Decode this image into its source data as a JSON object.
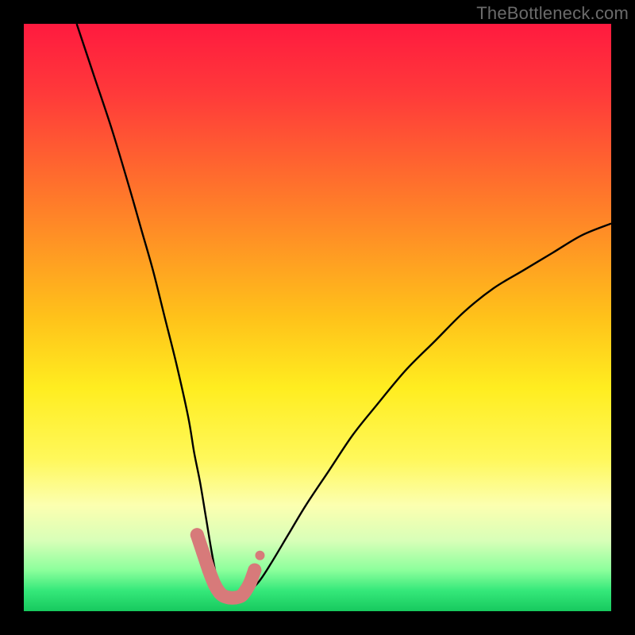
{
  "watermark": "TheBottleneck.com",
  "chart_data": {
    "type": "line",
    "title": "",
    "xlabel": "",
    "ylabel": "",
    "xlim": [
      0,
      100
    ],
    "ylim": [
      0,
      100
    ],
    "curve": {
      "name": "bottleneck-curve",
      "color": "#000000",
      "x": [
        9,
        12,
        15,
        18,
        20,
        22,
        24,
        26,
        28,
        29,
        30,
        31,
        32,
        33,
        34,
        35,
        36,
        37,
        38,
        40,
        42,
        45,
        48,
        52,
        56,
        60,
        65,
        70,
        75,
        80,
        85,
        90,
        95,
        100
      ],
      "y": [
        100,
        91,
        82,
        72,
        65,
        58,
        50,
        42,
        33,
        27,
        22,
        16,
        10,
        5,
        3,
        2,
        2,
        2,
        3,
        5,
        8,
        13,
        18,
        24,
        30,
        35,
        41,
        46,
        51,
        55,
        58,
        61,
        64,
        66
      ]
    },
    "highlight_segment": {
      "color": "#d77a7a",
      "x": [
        29.5,
        30.5,
        31.5,
        32.5,
        33.3,
        34,
        35,
        36,
        37,
        37.7,
        38.5,
        39.3
      ],
      "y": [
        13,
        10,
        7,
        4.5,
        3.2,
        2.6,
        2.3,
        2.3,
        2.6,
        3.4,
        4.8,
        7
      ]
    },
    "highlight_outlier": {
      "color": "#d77a7a",
      "x": 40.2,
      "y": 9.5
    },
    "background_gradient": {
      "stops": [
        {
          "offset": 0.0,
          "color": "#ff1a3f"
        },
        {
          "offset": 0.12,
          "color": "#ff3a3a"
        },
        {
          "offset": 0.3,
          "color": "#ff7a2a"
        },
        {
          "offset": 0.5,
          "color": "#ffc21a"
        },
        {
          "offset": 0.62,
          "color": "#ffed20"
        },
        {
          "offset": 0.74,
          "color": "#fff85a"
        },
        {
          "offset": 0.82,
          "color": "#fcffb0"
        },
        {
          "offset": 0.88,
          "color": "#d8ffb8"
        },
        {
          "offset": 0.93,
          "color": "#8cff9c"
        },
        {
          "offset": 0.965,
          "color": "#35e87a"
        },
        {
          "offset": 1.0,
          "color": "#17c95e"
        }
      ]
    }
  }
}
